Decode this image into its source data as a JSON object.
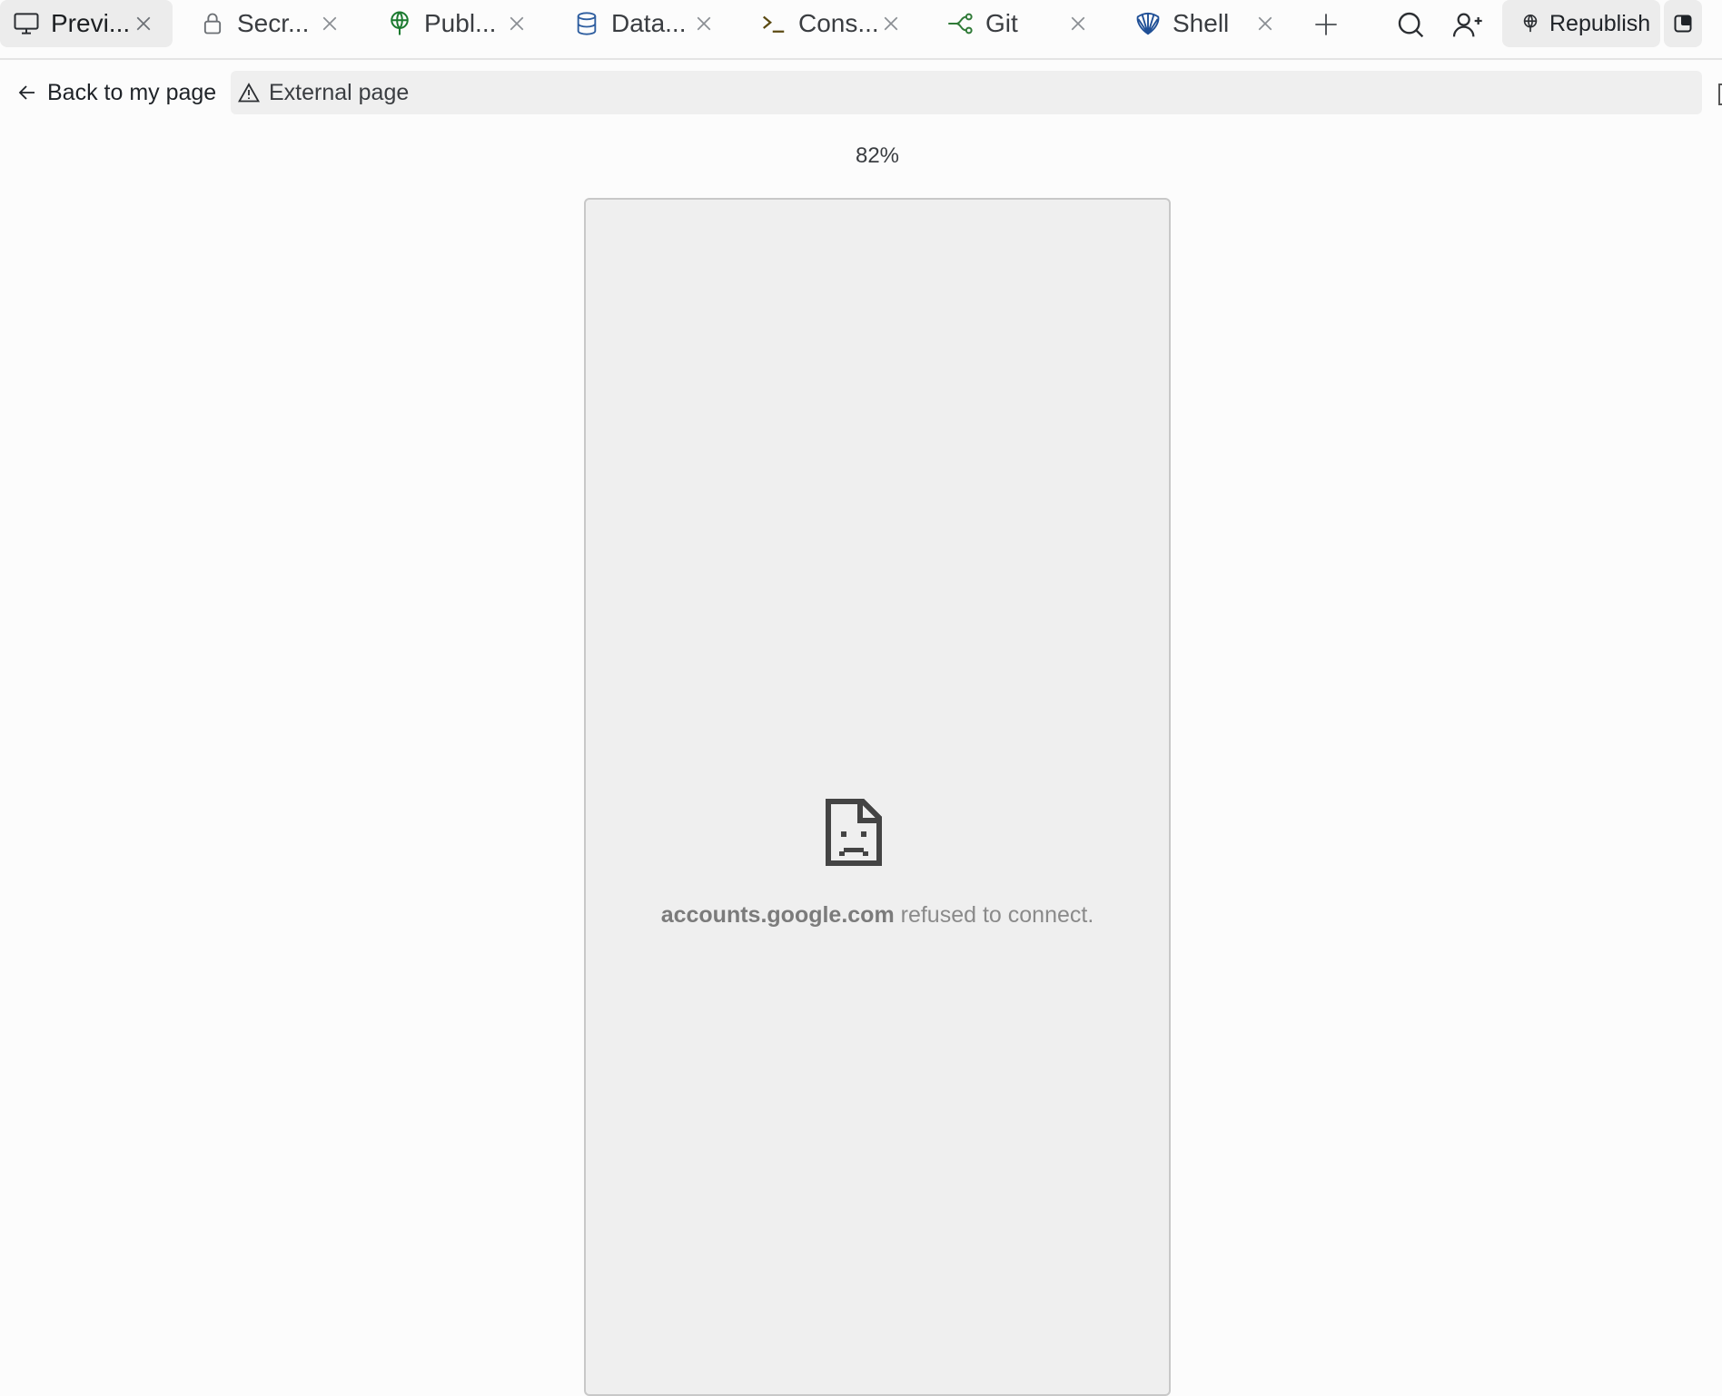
{
  "tabs": [
    {
      "label": "Previ...",
      "icon": "monitor-icon",
      "active": true
    },
    {
      "label": "Secr...",
      "icon": "lock-icon",
      "active": false
    },
    {
      "label": "Publ...",
      "icon": "globe-icon",
      "active": false
    },
    {
      "label": "Data...",
      "icon": "database-icon",
      "active": false
    },
    {
      "label": "Cons...",
      "icon": "terminal-icon",
      "active": false
    },
    {
      "label": "Git",
      "icon": "git-branch-icon",
      "active": false
    },
    {
      "label": "Shell",
      "icon": "shell-icon",
      "active": false
    }
  ],
  "toolbar": {
    "add_tab_icon": "plus-icon",
    "search_icon": "search-icon",
    "invite_icon": "add-user-icon",
    "republish_label": "Republish"
  },
  "address_bar": {
    "back_label": "Back to my page",
    "url_text": "External page"
  },
  "preview": {
    "zoom": "82%",
    "error_host": "accounts.google.com",
    "error_suffix": " refused to connect."
  },
  "colors": {
    "globe": "#1b7a2f",
    "database": "#2d5d9f",
    "terminal": "#5b4a12",
    "git": "#2f7a37",
    "shell": "#1f4f96"
  }
}
